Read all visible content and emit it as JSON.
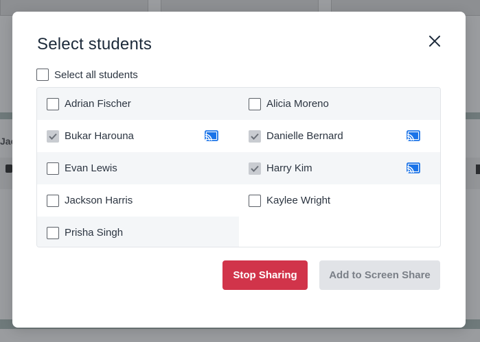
{
  "background": {
    "partial_text": "Jac"
  },
  "modal": {
    "title": "Select students",
    "select_all_label": "Select all students",
    "students": [
      {
        "name": "Adrian Fischer",
        "checked": false,
        "sharing": false
      },
      {
        "name": "Alicia Moreno",
        "checked": false,
        "sharing": false
      },
      {
        "name": "Bukar Harouna",
        "checked": true,
        "sharing": true
      },
      {
        "name": "Danielle Bernard",
        "checked": true,
        "sharing": true
      },
      {
        "name": "Evan Lewis",
        "checked": false,
        "sharing": false
      },
      {
        "name": "Harry Kim",
        "checked": true,
        "sharing": true
      },
      {
        "name": "Jackson Harris",
        "checked": false,
        "sharing": false
      },
      {
        "name": "Kaylee Wright",
        "checked": false,
        "sharing": false
      },
      {
        "name": "Prisha Singh",
        "checked": false,
        "sharing": false
      }
    ],
    "buttons": {
      "stop_sharing": "Stop Sharing",
      "add_to_share": "Add to Screen Share"
    }
  },
  "icons": {
    "close": "close-icon",
    "cast": "cast-icon",
    "check": "check-icon"
  },
  "colors": {
    "title": "#1c2a3a",
    "danger": "#d1344a",
    "disabled_bg": "#e1e3e7",
    "disabled_text": "#7a7f87",
    "cast_blue": "#1a73e8",
    "checked_bg": "#c9ccd1"
  }
}
